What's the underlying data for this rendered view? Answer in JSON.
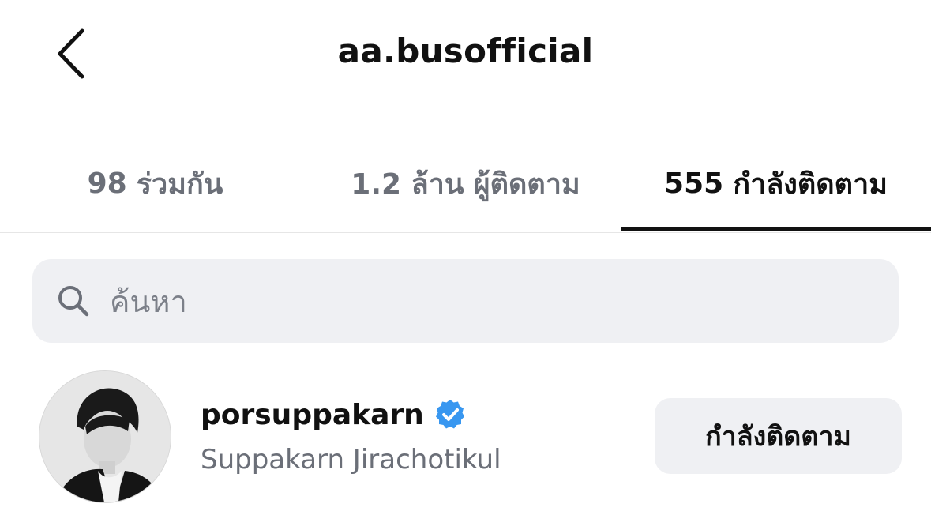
{
  "header": {
    "title": "aa.busofficial",
    "back_icon": "chevron-left-icon"
  },
  "tabs": [
    {
      "count": "98",
      "label": "ร่วมกัน",
      "active": false
    },
    {
      "count": "1.2 ล้าน",
      "label": "ผู้ติดตาม",
      "active": false
    },
    {
      "count": "555",
      "label": "กำลังติดตาม",
      "active": true
    }
  ],
  "search": {
    "icon": "search-icon",
    "placeholder": "ค้นหา"
  },
  "users": [
    {
      "username": "porsuppakarn",
      "verified": true,
      "full_name": "Suppakarn Jirachotikul",
      "button_label": "กำลังติดตาม"
    }
  ],
  "colors": {
    "text_primary": "#111111",
    "text_secondary": "#6b6f78",
    "surface": "#eff0f3",
    "verified_blue": "#3897f0",
    "divider": "#e6e6e6"
  }
}
